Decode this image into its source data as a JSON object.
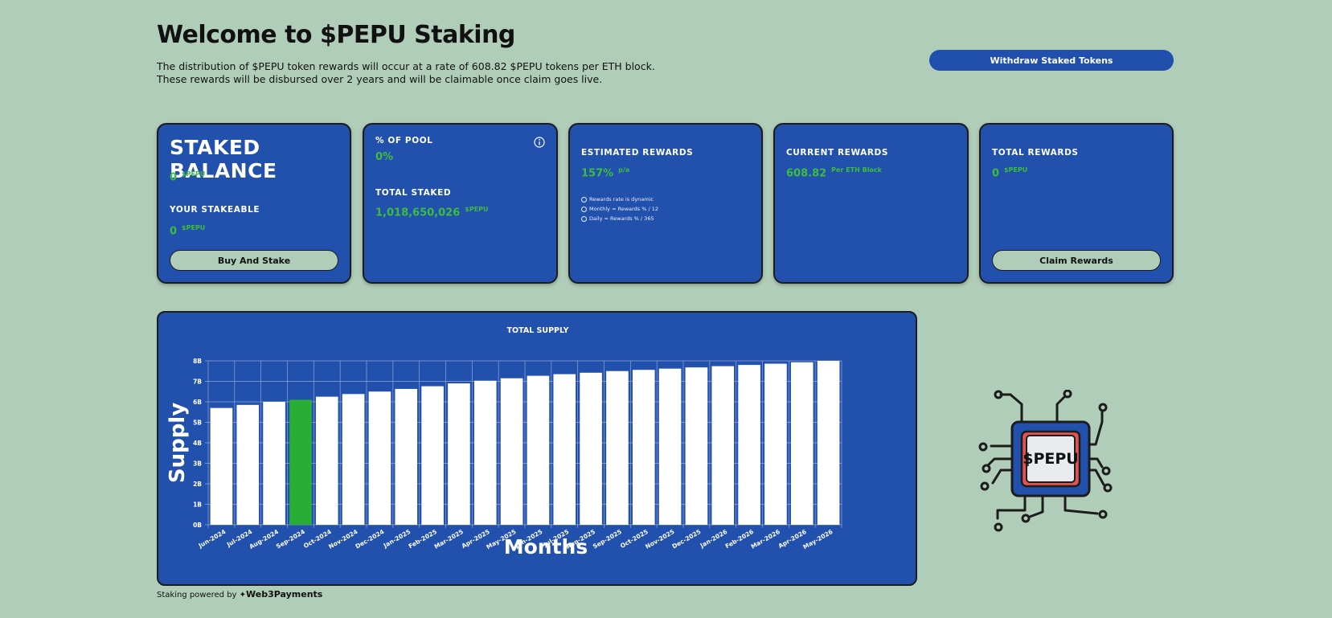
{
  "header": {
    "title": "Welcome to $PEPU Staking",
    "intro": "The distribution of $PEPU token rewards will occur at a rate of 608.82 $PEPU tokens per ETH block. These rewards will be disbursed over 2 years and will be claimable once claim goes live.",
    "withdraw_label": "Withdraw Staked Tokens"
  },
  "cards": {
    "staked": {
      "title": "STAKED BALANCE",
      "balance": "0",
      "balance_unit": "$PEPU",
      "stakeable_label": "YOUR STAKEABLE",
      "stakeable": "0",
      "stakeable_unit": "$PEPU",
      "button": "Buy And Stake"
    },
    "pool": {
      "pct_label": "% OF POOL",
      "pct_value": "0%",
      "total_label": "TOTAL STAKED",
      "total_value": "1,018,650,026",
      "total_unit": "$PEPU"
    },
    "estimated": {
      "label": "ESTIMATED REWARDS",
      "value": "157%",
      "unit": "p/a",
      "notes": [
        "Rewards rate is dynamic",
        "Monthly = Rewards % / 12",
        "Daily = Rewards % / 365"
      ]
    },
    "current": {
      "label": "CURRENT REWARDS",
      "value": "608.82",
      "unit": "Per ETH Block"
    },
    "total": {
      "label": "TOTAL REWARDS",
      "value": "0",
      "unit": "$PEPU",
      "button": "Claim Rewards"
    }
  },
  "chart_data": {
    "type": "bar",
    "title": "TOTAL SUPPLY",
    "xlabel": "Months",
    "ylabel": "Supply",
    "categories": [
      "Jun-2024",
      "Jul-2024",
      "Aug-2024",
      "Sep-2024",
      "Oct-2024",
      "Nov-2024",
      "Dec-2024",
      "Jan-2025",
      "Feb-2025",
      "Mar-2025",
      "Apr-2025",
      "May-2025",
      "Jun-2025",
      "Jul-2025",
      "Aug-2025",
      "Sep-2025",
      "Oct-2025",
      "Nov-2025",
      "Dec-2025",
      "Jan-2026",
      "Feb-2026",
      "Mar-2026",
      "Apr-2026",
      "May-2026"
    ],
    "values": [
      5.7,
      5.85,
      6.0,
      6.1,
      6.25,
      6.38,
      6.5,
      6.63,
      6.76,
      6.9,
      7.03,
      7.15,
      7.27,
      7.35,
      7.42,
      7.5,
      7.56,
      7.62,
      7.68,
      7.74,
      7.8,
      7.86,
      7.93,
      8.0
    ],
    "highlight_index": 3,
    "yticks": [
      "0B",
      "1B",
      "2B",
      "3B",
      "4B",
      "5B",
      "6B",
      "7B",
      "8B"
    ],
    "ylim": [
      0,
      8
    ],
    "colors": {
      "bar": "#ffffff",
      "highlight": "#2aad35",
      "grid": "#8fa6d8"
    }
  },
  "footer": {
    "prefix": "Staking powered by",
    "brand": "Web3Payments"
  },
  "logo": {
    "text": "$PEPU"
  },
  "colors": {
    "background": "#b0cdb9",
    "card": "#2250ad",
    "accent_green": "#3dbd3d"
  }
}
